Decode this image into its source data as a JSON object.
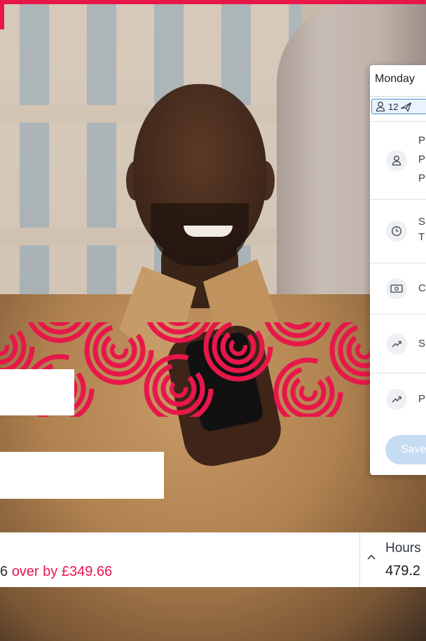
{
  "card": {
    "day": "Monday",
    "chip": {
      "count": "12"
    },
    "rows": [
      {
        "icon": "person-icon",
        "lines": [
          "P",
          "P",
          "P"
        ]
      },
      {
        "icon": "clock-icon",
        "lines": [
          "S",
          "T"
        ]
      },
      {
        "icon": "cash-icon",
        "lines": [
          "C"
        ]
      },
      {
        "icon": "trend-up-icon",
        "lines": [
          "S"
        ]
      },
      {
        "icon": "trend-up-icon",
        "lines": [
          "P"
        ]
      }
    ],
    "save_label": "Save"
  },
  "footer": {
    "budget_prefix": "6",
    "budget_over": "over by £349.66",
    "hours_label": "Hours",
    "hours_value": "479.2"
  },
  "colors": {
    "brand": "#e8174a",
    "accent_blue": "#4a8fd8",
    "save_disabled": "#c5dcf3"
  }
}
